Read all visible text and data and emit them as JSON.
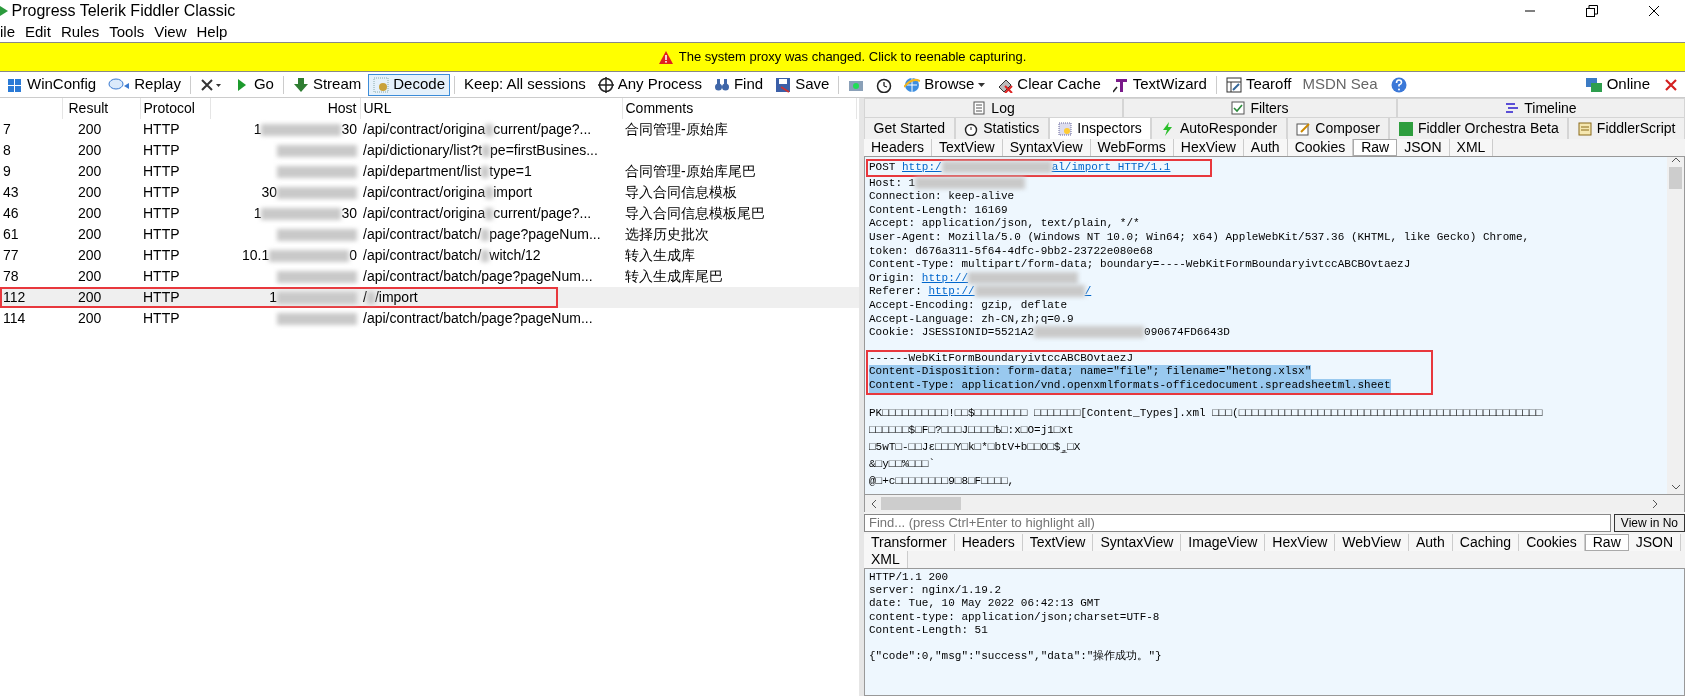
{
  "window": {
    "title": "Progress Telerik Fiddler Classic"
  },
  "menu": [
    "ile",
    "Edit",
    "Rules",
    "Tools",
    "View",
    "Help"
  ],
  "notification": {
    "text": "The system proxy was changed. Click to reenable capturing."
  },
  "toolbar": {
    "items": [
      {
        "label": "WinConfig",
        "kind": "button",
        "pressed": false
      },
      {
        "label": "Replay",
        "kind": "button",
        "pressed": false
      },
      {
        "kind": "menu",
        "pressed": false
      },
      {
        "label": "Go",
        "kind": "button",
        "pressed": false
      },
      {
        "label": "Stream",
        "kind": "button",
        "pressed": false
      },
      {
        "label": "Decode",
        "kind": "button",
        "pressed": true
      },
      {
        "label": "Keep: All sessions",
        "kind": "menu",
        "pressed": false
      },
      {
        "label": "Any Process",
        "kind": "button",
        "pressed": false
      },
      {
        "label": "Find",
        "kind": "button",
        "pressed": false
      },
      {
        "label": "Save",
        "kind": "button",
        "pressed": false
      },
      {
        "kind": "button",
        "pressed": false
      },
      {
        "kind": "button",
        "pressed": false
      },
      {
        "label": "Browse",
        "kind": "menu",
        "pressed": false
      },
      {
        "label": "Clear Cache",
        "kind": "button",
        "pressed": false
      },
      {
        "label": "TextWizard",
        "kind": "button",
        "pressed": false
      },
      {
        "label": "Tearoff",
        "kind": "button",
        "pressed": false
      }
    ],
    "search_value": "MSDN Sea",
    "online": "Online"
  },
  "sessions": {
    "columns": [
      "Result",
      "Protocol",
      "Host",
      "URL",
      "Comments"
    ],
    "rows": [
      {
        "id": "7",
        "result": "200",
        "protocol": "HTTP",
        "host": [
          "1",
          "30"
        ],
        "url": [
          "/api/contract/origina",
          "current/page?..."
        ],
        "comments": "合同管理-原始库",
        "selected": false,
        "annotated": false
      },
      {
        "id": "8",
        "result": "200",
        "protocol": "HTTP",
        "host": [],
        "url": [
          "/api/dictionary/list?t",
          "pe=firstBusines..."
        ],
        "selected": false,
        "annotated": false
      },
      {
        "id": "9",
        "result": "200",
        "protocol": "HTTP",
        "host": [],
        "url": [
          "/api/department/list",
          "type=1"
        ],
        "comments": "合同管理-原始库尾巴",
        "selected": false,
        "annotated": false
      },
      {
        "id": "43",
        "result": "200",
        "protocol": "HTTP",
        "host": [
          "30"
        ],
        "url": [
          "/api/contract/origina",
          "import"
        ],
        "comments": "导入合同信息模板",
        "selected": false,
        "annotated": false
      },
      {
        "id": "46",
        "result": "200",
        "protocol": "HTTP",
        "host": [
          "1",
          "30"
        ],
        "url": [
          "/api/contract/origina",
          "current/page?..."
        ],
        "comments": "导入合同信息模板尾巴",
        "selected": false,
        "annotated": false
      },
      {
        "id": "61",
        "result": "200",
        "protocol": "HTTP",
        "host": [],
        "url": [
          "/api/contract/batch/",
          "page?pageNum..."
        ],
        "comments": "选择历史批次",
        "selected": false,
        "annotated": false
      },
      {
        "id": "77",
        "result": "200",
        "protocol": "HTTP",
        "host": [
          "10.1",
          "0"
        ],
        "url": [
          "/api/contract/batch/",
          "witch/12"
        ],
        "comments": "转入生成库",
        "selected": false,
        "annotated": false
      },
      {
        "id": "78",
        "result": "200",
        "protocol": "HTTP",
        "host": [],
        "url": [
          "/api/contract/batch/page?pageNum..."
        ],
        "comments": "转入生成库尾巴",
        "selected": false,
        "annotated": false
      },
      {
        "id": "112",
        "result": "200",
        "protocol": "HTTP",
        "host": [
          "1"
        ],
        "url": [
          "/",
          "/import"
        ],
        "selected": true,
        "annotated": true
      },
      {
        "id": "114",
        "result": "200",
        "protocol": "HTTP",
        "host": [],
        "url": [
          "/api/contract/batch/page?pageNum..."
        ],
        "selected": false,
        "annotated": false
      }
    ]
  },
  "top_tabs": [
    {
      "label": "Log",
      "selected": false
    },
    {
      "label": "Filters",
      "selected": false
    },
    {
      "label": "Timeline",
      "selected": false
    }
  ],
  "main_tabs": [
    {
      "label": "Get Started",
      "selected": false
    },
    {
      "label": "Statistics",
      "selected": false
    },
    {
      "label": "Inspectors",
      "selected": true
    },
    {
      "label": "AutoResponder",
      "selected": false
    },
    {
      "label": "Composer",
      "selected": false
    },
    {
      "label": "Fiddler Orchestra Beta",
      "selected": false
    },
    {
      "label": "FiddlerScript",
      "selected": false
    }
  ],
  "request": {
    "tabs": [
      {
        "label": "Headers",
        "selected": false
      },
      {
        "label": "TextView",
        "selected": false
      },
      {
        "label": "SyntaxView",
        "selected": false
      },
      {
        "label": "WebForms",
        "selected": false
      },
      {
        "label": "HexView",
        "selected": false
      },
      {
        "label": "Auth",
        "selected": false
      },
      {
        "label": "Cookies",
        "selected": false
      },
      {
        "label": "Raw",
        "selected": true
      },
      {
        "label": "JSON",
        "selected": false
      },
      {
        "label": "XML",
        "selected": false
      }
    ],
    "groups": [
      {
        "annotated": true,
        "lines": [
          {
            "kind": "plain",
            "segments": [
              {
                "kind": "text",
                "text": "POST "
              },
              {
                "kind": "link",
                "text": "http:/"
              },
              {
                "kind": "blur"
              },
              {
                "kind": "link",
                "text": "al/import HTTP/1.1"
              }
            ]
          }
        ]
      },
      {
        "annotated": false,
        "lines": [
          {
            "kind": "plain",
            "segments": [
              {
                "kind": "text",
                "text": "Host: 1"
              },
              {
                "kind": "blur"
              }
            ]
          },
          {
            "kind": "plain",
            "segments": [
              {
                "kind": "text",
                "text": "Connection: keep-alive"
              }
            ]
          },
          {
            "kind": "plain",
            "segments": [
              {
                "kind": "text",
                "text": "Content-Length: 16169"
              }
            ]
          },
          {
            "kind": "plain",
            "segments": [
              {
                "kind": "text",
                "text": "Accept: application/json, text/plain, */*"
              }
            ]
          },
          {
            "kind": "plain",
            "segments": [
              {
                "kind": "text",
                "text": "User-Agent: Mozilla/5.0 (Windows NT 10.0; Win64; x64) AppleWebKit/537.36 (KHTML, like Gecko) Chrome,"
              }
            ]
          },
          {
            "kind": "plain",
            "segments": [
              {
                "kind": "text",
                "text": "token: d676a311-5f64-4dfc-9bb2-23722e080e68"
              }
            ]
          },
          {
            "kind": "plain",
            "segments": [
              {
                "kind": "text",
                "text": "Content-Type: multipart/form-data; boundary=----WebKitFormBoundaryivtccABCBOvtaezJ"
              }
            ]
          },
          {
            "kind": "plain",
            "segments": [
              {
                "kind": "text",
                "text": "Origin: "
              },
              {
                "kind": "link",
                "text": "http://"
              },
              {
                "kind": "blur"
              }
            ]
          },
          {
            "kind": "plain",
            "segments": [
              {
                "kind": "text",
                "text": "Referer: "
              },
              {
                "kind": "link",
                "text": "http://"
              },
              {
                "kind": "blur"
              },
              {
                "kind": "link",
                "text": "/"
              }
            ]
          },
          {
            "kind": "plain",
            "segments": [
              {
                "kind": "text",
                "text": "Accept-Encoding: gzip, deflate"
              }
            ]
          },
          {
            "kind": "plain",
            "segments": [
              {
                "kind": "text",
                "text": "Accept-Language: zh-CN,zh;q=0.9"
              }
            ]
          },
          {
            "kind": "plain",
            "segments": [
              {
                "kind": "text",
                "text": "Cookie: JSESSIONID=5521A2"
              },
              {
                "kind": "blur"
              },
              {
                "kind": "text",
                "text": "090674FD6643D"
              }
            ]
          }
        ]
      },
      {
        "annotated": true,
        "lines": [
          {
            "kind": "plain",
            "segments": [
              {
                "kind": "text",
                "text": "------WebKitFormBoundaryivtccABCBOvtaezJ"
              }
            ]
          },
          {
            "kind": "selected",
            "segments": [
              {
                "kind": "text",
                "text": "Content-Disposition: form-data; name=\"file\"; filename=\"hetong.xlsx\""
              }
            ]
          },
          {
            "kind": "selected",
            "segments": [
              {
                "kind": "text",
                "text": "Content-Type: application/vnd.openxmlformats-officedocument.spreadsheetml.sheet"
              }
            ]
          }
        ]
      },
      {
        "annotated": false,
        "lines": [
          {
            "kind": "binary",
            "segments": [
              {
                "kind": "text",
                "text": "PK□□□□□□□□□□!□□$□□□□□□□□ □□□□□□□[Content_Types].xml □□□(□□□□□□□□□□□□□□□□□□□□□□□□□□□□□□□□□□□□□□□□□□□□□□"
              }
            ]
          },
          {
            "kind": "binary",
            "segments": [
              {
                "kind": "text",
                "text": "□□□□□□$□F□?□□□J□□□□ѣ□:x□O=j1□xt"
              }
            ]
          },
          {
            "kind": "binary",
            "segments": [
              {
                "kind": "text",
                "text": "□5wT□-□□Jɛ□□□Y□k□*□btV+b□□O□$_ٍ□X"
              }
            ]
          },
          {
            "kind": "binary",
            "segments": [
              {
                "kind": "text",
                "text": "&□y□□%□□□`"
              }
            ]
          },
          {
            "kind": "binary",
            "segments": [
              {
                "kind": "text",
                "text": "@□+c□□□□□□□□9□8□F□□□□,"
              }
            ]
          }
        ]
      }
    ],
    "find_placeholder": "Find... (press Ctrl+Enter to highlight all)",
    "view_button": "View in No"
  },
  "response": {
    "tabs": [
      {
        "label": "Transformer",
        "selected": false
      },
      {
        "label": "Headers",
        "selected": false
      },
      {
        "label": "TextView",
        "selected": false
      },
      {
        "label": "SyntaxView",
        "selected": false
      },
      {
        "label": "ImageView",
        "selected": false
      },
      {
        "label": "HexView",
        "selected": false
      },
      {
        "label": "WebView",
        "selected": false
      },
      {
        "label": "Auth",
        "selected": false
      },
      {
        "label": "Caching",
        "selected": false
      },
      {
        "label": "Cookies",
        "selected": false
      },
      {
        "label": "Raw",
        "selected": true
      },
      {
        "label": "JSON",
        "selected": false
      },
      {
        "label": "XML",
        "selected": false
      }
    ],
    "headers": [
      "HTTP/1.1 200",
      "server: nginx/1.19.2",
      "date: Tue, 10 May 2022 06:42:13 GMT",
      "content-type: application/json;charset=UTF-8",
      "Content-Length: 51"
    ],
    "body": "{\"code\":0,\"msg\":\"success\",\"data\":\"操作成功。\"}"
  }
}
